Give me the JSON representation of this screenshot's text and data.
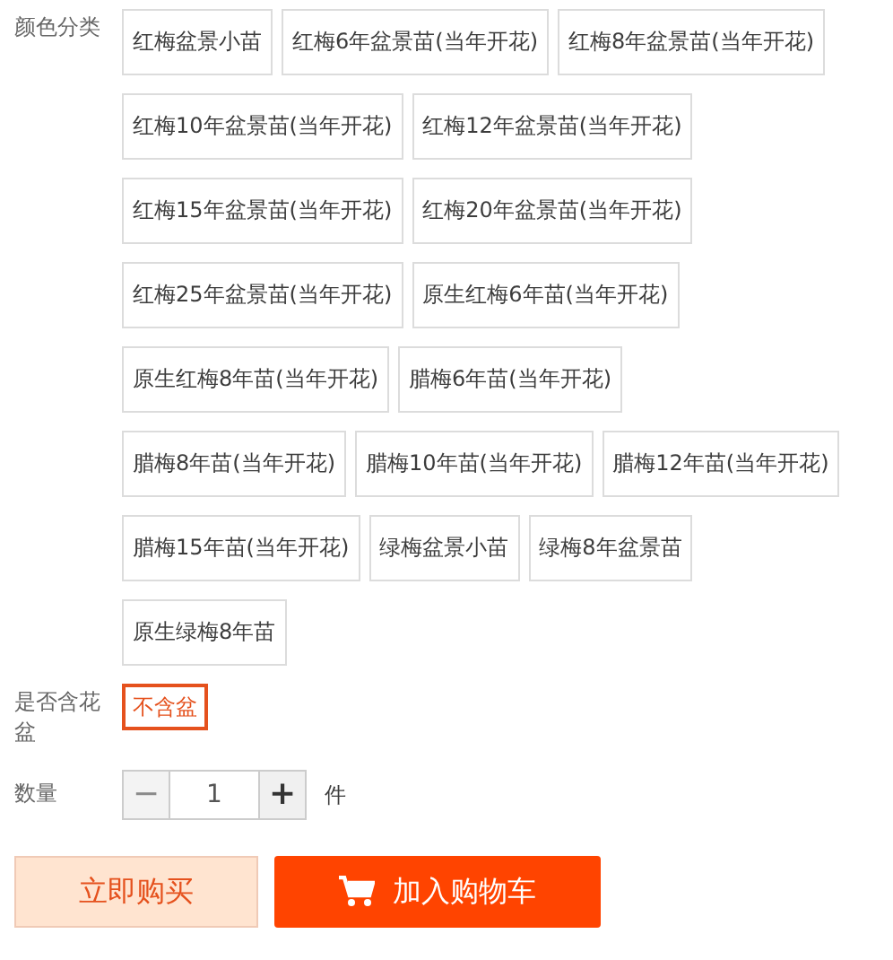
{
  "sku_groups": [
    {
      "label": "颜色分类",
      "options": [
        {
          "text": "红梅盆景小苗",
          "selected": false
        },
        {
          "text": "红梅6年盆景苗(当年开花)",
          "selected": false
        },
        {
          "text": "红梅8年盆景苗(当年开花)",
          "selected": false
        },
        {
          "text": "红梅10年盆景苗(当年开花)",
          "selected": false
        },
        {
          "text": "红梅12年盆景苗(当年开花)",
          "selected": false
        },
        {
          "text": "红梅15年盆景苗(当年开花)",
          "selected": false
        },
        {
          "text": "红梅20年盆景苗(当年开花)",
          "selected": false
        },
        {
          "text": "红梅25年盆景苗(当年开花)",
          "selected": false
        },
        {
          "text": "原生红梅6年苗(当年开花)",
          "selected": false
        },
        {
          "text": "原生红梅8年苗(当年开花)",
          "selected": false
        },
        {
          "text": "腊梅6年苗(当年开花)",
          "selected": false
        },
        {
          "text": "腊梅8年苗(当年开花)",
          "selected": false
        },
        {
          "text": "腊梅10年苗(当年开花)",
          "selected": false
        },
        {
          "text": "腊梅12年苗(当年开花)",
          "selected": false
        },
        {
          "text": "腊梅15年苗(当年开花)",
          "selected": false
        },
        {
          "text": "绿梅盆景小苗",
          "selected": false
        },
        {
          "text": "绿梅8年盆景苗",
          "selected": false
        },
        {
          "text": "原生绿梅8年苗",
          "selected": false
        }
      ]
    },
    {
      "label": "是否含花盆",
      "options": [
        {
          "text": "不含盆",
          "selected": true
        }
      ]
    }
  ],
  "quantity": {
    "label": "数量",
    "minus": "−",
    "minus_disabled": true,
    "value": "1",
    "plus": "+",
    "unit": "件"
  },
  "buttons": [
    {
      "kind": "buy",
      "text": "立即购买"
    },
    {
      "kind": "cart",
      "text": "加入购物车"
    }
  ]
}
